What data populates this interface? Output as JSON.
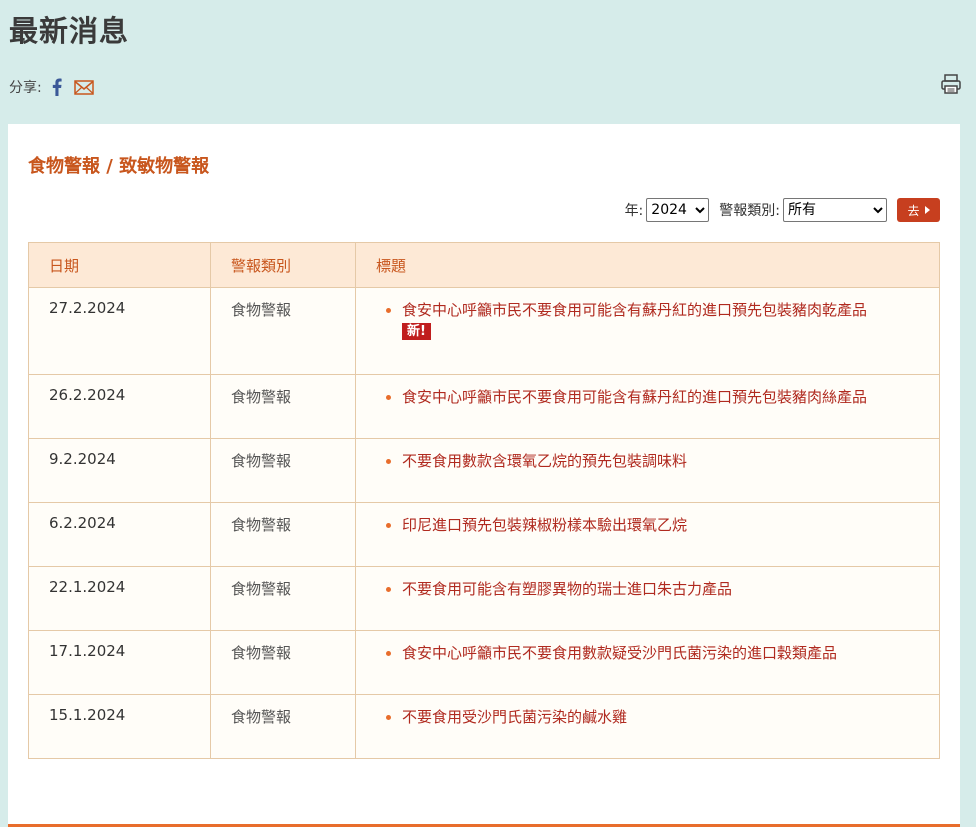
{
  "page": {
    "title": "最新消息"
  },
  "share": {
    "label": "分享:",
    "icons": [
      "facebook-icon",
      "email-icon"
    ]
  },
  "print": {
    "icon": "printer-icon"
  },
  "section": {
    "title": "食物警報 / 致敏物警報"
  },
  "filters": {
    "year_label": "年:",
    "year_value": "2024",
    "type_label": "警報類別:",
    "type_value": "所有",
    "go_label": "去"
  },
  "table": {
    "headers": {
      "date": "日期",
      "type": "警報類別",
      "title": "標題"
    },
    "rows": [
      {
        "date": "27.2.2024",
        "type": "食物警報",
        "title": "食安中心呼籲市民不要食用可能含有蘇丹紅的進口預先包裝豬肉乾產品",
        "badge": "新!"
      },
      {
        "date": "26.2.2024",
        "type": "食物警報",
        "title": "食安中心呼籲市民不要食用可能含有蘇丹紅的進口預先包裝豬肉絲產品"
      },
      {
        "date": "9.2.2024",
        "type": "食物警報",
        "title": "不要食用數款含環氧乙烷的預先包裝調味料"
      },
      {
        "date": "6.2.2024",
        "type": "食物警報",
        "title": "印尼進口預先包裝辣椒粉樣本驗出環氧乙烷"
      },
      {
        "date": "22.1.2024",
        "type": "食物警報",
        "title": "不要食用可能含有塑膠異物的瑞士進口朱古力產品"
      },
      {
        "date": "17.1.2024",
        "type": "食物警報",
        "title": "食安中心呼籲市民不要食用數款疑受沙門氏菌污染的進口穀類產品"
      },
      {
        "date": "15.1.2024",
        "type": "食物警報",
        "title": "不要食用受沙門氏菌污染的鹹水雞"
      }
    ]
  },
  "colors": {
    "background": "#d6ecea",
    "accent_orange": "#e86d2c",
    "heading_orange": "#c8561d",
    "link_red": "#b02a1f",
    "badge_red": "#c01e1e",
    "facebook_blue": "#3b5998"
  }
}
